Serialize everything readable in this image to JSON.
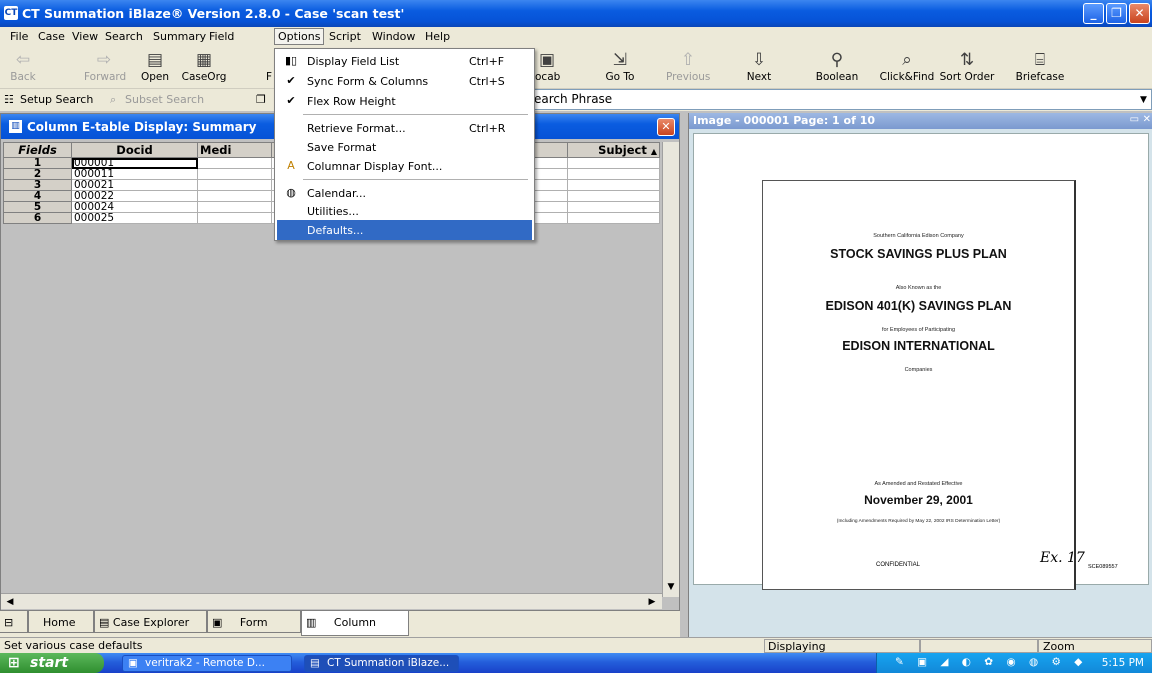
{
  "window": {
    "title": "CT Summation iBlaze® Version 2.8.0 - Case 'scan test'"
  },
  "menubar": [
    "File",
    "Case",
    "View",
    "Search",
    "Summary",
    "Field",
    "Options",
    "Script",
    "Window",
    "Help"
  ],
  "toolbar": {
    "back": "Back",
    "forward": "Forward",
    "open": "Open",
    "caseorg": "CaseOrg",
    "caseorg_cut": "F",
    "vocab": "ocab",
    "goto": "Go To",
    "previous": "Previous",
    "next": "Next",
    "boolean": "Boolean",
    "clickfind": "Click&Find",
    "sortorder": "Sort Order",
    "briefcase": "Briefcase"
  },
  "searchbar": {
    "setup": "Setup Search",
    "subset": "Subset Search",
    "phrase": "earch Phrase"
  },
  "options_menu": {
    "items": [
      {
        "label": "Display Field List",
        "shortcut": "Ctrl+F"
      },
      {
        "label": "Sync Form & Columns",
        "shortcut": "Ctrl+S"
      },
      {
        "label": "Flex Row Height",
        "shortcut": ""
      },
      {
        "label": "Retrieve Format...",
        "shortcut": "Ctrl+R"
      },
      {
        "label": "Save Format",
        "shortcut": ""
      },
      {
        "label": "Columnar Display Font...",
        "shortcut": ""
      },
      {
        "label": "Calendar...",
        "shortcut": ""
      },
      {
        "label": "Utilities...",
        "shortcut": ""
      },
      {
        "label": "Defaults...",
        "shortcut": ""
      }
    ]
  },
  "left_panel": {
    "title": "Column E-table Display: Summary",
    "headers": {
      "fields": "Fields",
      "docid": "Docid",
      "medium": "Medi",
      "subject": "Subject"
    },
    "rows": [
      {
        "n": "1",
        "docid": "000001"
      },
      {
        "n": "2",
        "docid": "000011"
      },
      {
        "n": "3",
        "docid": "000021"
      },
      {
        "n": "4",
        "docid": "000022"
      },
      {
        "n": "5",
        "docid": "000024"
      },
      {
        "n": "6",
        "docid": "000025"
      }
    ]
  },
  "tabs": [
    "Home",
    "Case Explorer",
    "Form",
    "Column"
  ],
  "viewer": {
    "title": "Image - 000001 Page: 1 of 10",
    "doc": {
      "company": "Southern California Edison Company",
      "plan": "STOCK SAVINGS PLUS PLAN",
      "aka": "Also Known as the",
      "plan401k": "EDISON 401(K) SAVINGS PLAN",
      "for": "for Employees of Participating",
      "intl": "EDISON INTERNATIONAL",
      "companies": "Companies",
      "amended": "As Amended and Restated Effective",
      "date": "November 29, 2001",
      "including": "(Including Amendments Required by May 22, 2002 IRS Determination Letter)",
      "confidential": "CONFIDENTIAL",
      "handwritten": "Ex. 17",
      "batesno": "SCE089557"
    }
  },
  "statusbar": {
    "message": "Set various case defaults",
    "displaying": "Displaying",
    "zoom": "Zoom"
  },
  "taskbar": {
    "start": "start",
    "task1": "veritrak2 - Remote D...",
    "task2": "CT Summation iBlaze...",
    "clock": "5:15 PM"
  }
}
